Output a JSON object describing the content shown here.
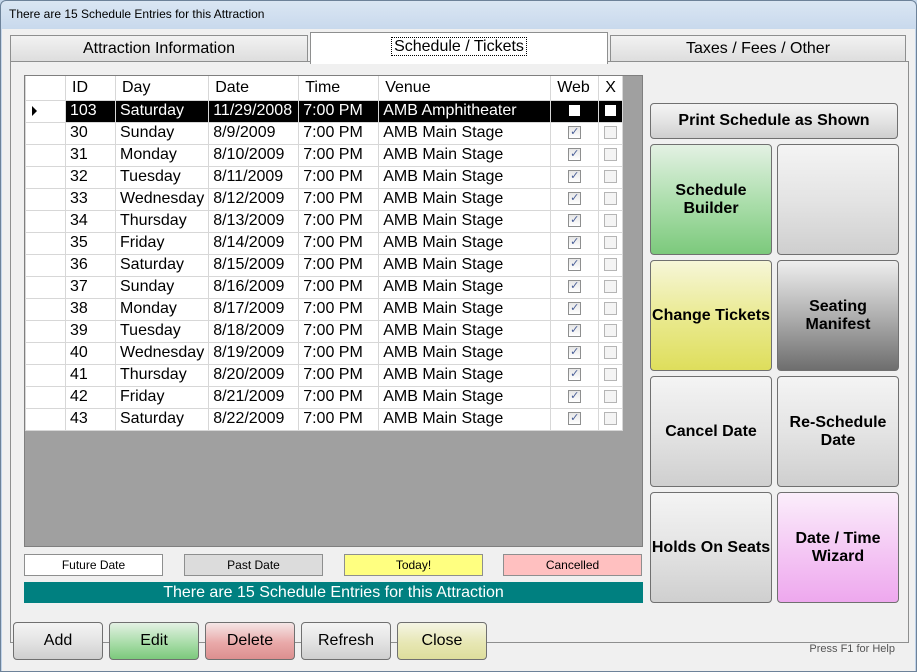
{
  "window": {
    "title": "There are 15 Schedule Entries for this Attraction"
  },
  "tabs": [
    {
      "label": "Attraction Information"
    },
    {
      "label": "Schedule / Tickets"
    },
    {
      "label": "Taxes / Fees / Other"
    }
  ],
  "grid": {
    "columns": [
      "ID",
      "Day",
      "Date",
      "Time",
      "Venue",
      "Web",
      "X"
    ],
    "rows": [
      {
        "id": "103",
        "day": "Saturday",
        "date": "11/29/2008",
        "time": "7:00 PM",
        "venue": "AMB Amphitheater",
        "web": false,
        "x": false
      },
      {
        "id": "30",
        "day": "Sunday",
        "date": "8/9/2009",
        "time": "7:00 PM",
        "venue": "AMB Main Stage",
        "web": true,
        "x": false
      },
      {
        "id": "31",
        "day": "Monday",
        "date": "8/10/2009",
        "time": "7:00 PM",
        "venue": "AMB Main Stage",
        "web": true,
        "x": false
      },
      {
        "id": "32",
        "day": "Tuesday",
        "date": "8/11/2009",
        "time": "7:00 PM",
        "venue": "AMB Main Stage",
        "web": true,
        "x": false
      },
      {
        "id": "33",
        "day": "Wednesday",
        "date": "8/12/2009",
        "time": "7:00 PM",
        "venue": "AMB Main Stage",
        "web": true,
        "x": false
      },
      {
        "id": "34",
        "day": "Thursday",
        "date": "8/13/2009",
        "time": "7:00 PM",
        "venue": "AMB Main Stage",
        "web": true,
        "x": false
      },
      {
        "id": "35",
        "day": "Friday",
        "date": "8/14/2009",
        "time": "7:00 PM",
        "venue": "AMB Main Stage",
        "web": true,
        "x": false
      },
      {
        "id": "36",
        "day": "Saturday",
        "date": "8/15/2009",
        "time": "7:00 PM",
        "venue": "AMB Main Stage",
        "web": true,
        "x": false
      },
      {
        "id": "37",
        "day": "Sunday",
        "date": "8/16/2009",
        "time": "7:00 PM",
        "venue": "AMB Main Stage",
        "web": true,
        "x": false
      },
      {
        "id": "38",
        "day": "Monday",
        "date": "8/17/2009",
        "time": "7:00 PM",
        "venue": "AMB Main Stage",
        "web": true,
        "x": false
      },
      {
        "id": "39",
        "day": "Tuesday",
        "date": "8/18/2009",
        "time": "7:00 PM",
        "venue": "AMB Main Stage",
        "web": true,
        "x": false
      },
      {
        "id": "40",
        "day": "Wednesday",
        "date": "8/19/2009",
        "time": "7:00 PM",
        "venue": "AMB Main Stage",
        "web": true,
        "x": false
      },
      {
        "id": "41",
        "day": "Thursday",
        "date": "8/20/2009",
        "time": "7:00 PM",
        "venue": "AMB Main Stage",
        "web": true,
        "x": false
      },
      {
        "id": "42",
        "day": "Friday",
        "date": "8/21/2009",
        "time": "7:00 PM",
        "venue": "AMB Main Stage",
        "web": true,
        "x": false
      },
      {
        "id": "43",
        "day": "Saturday",
        "date": "8/22/2009",
        "time": "7:00 PM",
        "venue": "AMB Main Stage",
        "web": true,
        "x": false
      }
    ]
  },
  "legend": {
    "future": "Future Date",
    "past": "Past Date",
    "today": "Today!",
    "cancelled": "Cancelled"
  },
  "status_text": "There are 15 Schedule Entries for this Attraction",
  "actions": {
    "print": "Print Schedule as Shown",
    "schedule_builder": "Schedule Builder",
    "blank": "",
    "change_tickets": "Change Tickets",
    "seating_manifest": "Seating Manifest",
    "cancel_date": "Cancel Date",
    "reschedule_date": "Re-Schedule Date",
    "holds_on_seats": "Holds On Seats",
    "date_time_wizard": "Date / Time Wizard"
  },
  "bottom": {
    "add": "Add",
    "edit": "Edit",
    "delete": "Delete",
    "refresh": "Refresh",
    "close": "Close",
    "help": "Press F1 for Help"
  },
  "colors": {
    "status_bar": "#008080",
    "past": "#dcdcdc",
    "today": "#ffff80",
    "cancelled": "#ffc0c0"
  }
}
